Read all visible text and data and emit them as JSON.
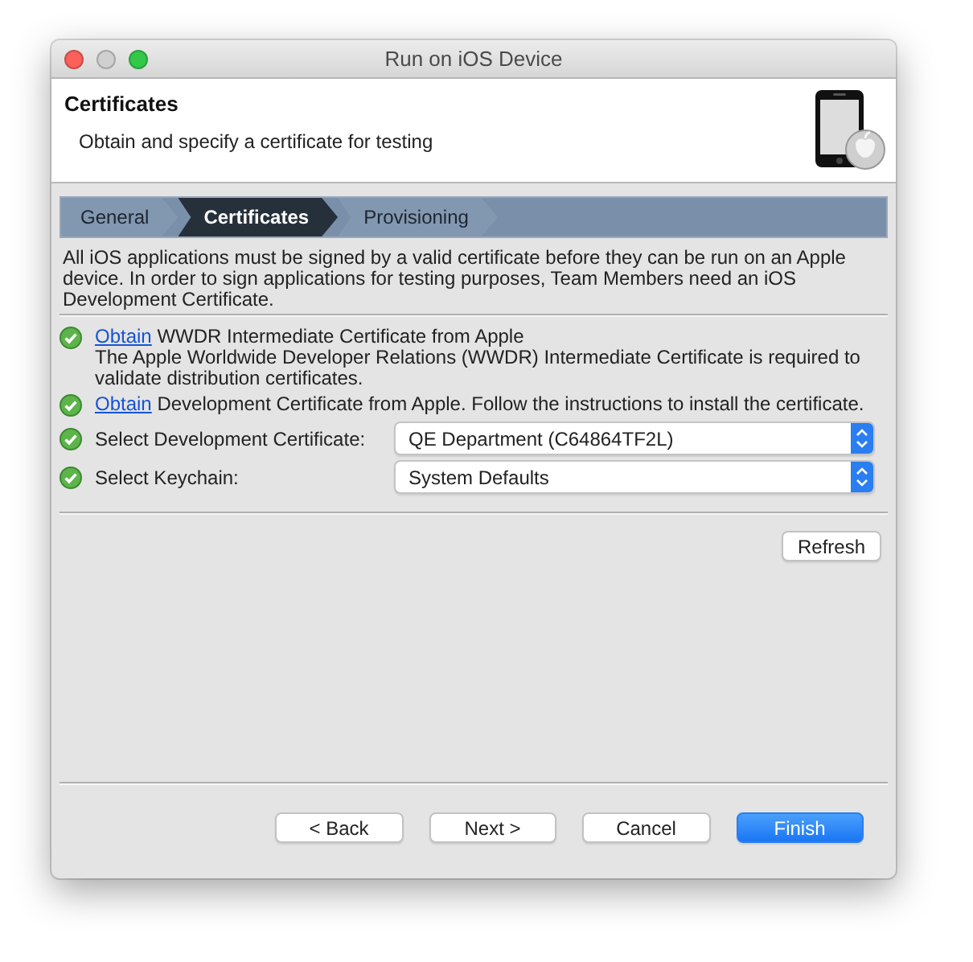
{
  "window": {
    "title": "Run on iOS Device"
  },
  "header": {
    "title": "Certificates",
    "subtitle": "Obtain and specify a certificate for testing"
  },
  "steps": [
    {
      "label": "General",
      "selected": false
    },
    {
      "label": "Certificates",
      "selected": true
    },
    {
      "label": "Provisioning",
      "selected": false
    }
  ],
  "description": "All iOS applications must be signed by a valid certificate before they can be run on an Apple device. In order to sign applications for testing purposes, Team Members need an iOS Development Certificate.",
  "rows": [
    {
      "kind": "link",
      "link": "Obtain",
      "text": "WWDR Intermediate Certificate from Apple",
      "detail": "The Apple Worldwide Developer Relations (WWDR) Intermediate Certificate is required to validate distribution certificates."
    },
    {
      "kind": "link",
      "link": "Obtain",
      "text": "Development Certificate from Apple. Follow the instructions to install the certificate."
    },
    {
      "kind": "select",
      "label": "Select Development Certificate:",
      "value": "QE Department (C64864TF2L)"
    },
    {
      "kind": "select",
      "label": "Select Keychain:",
      "value": "System Defaults"
    }
  ],
  "refresh_button": "Refresh",
  "buttons": [
    {
      "label": "< Back",
      "default": false
    },
    {
      "label": "Next >",
      "default": false
    },
    {
      "label": "Cancel",
      "default": false
    },
    {
      "label": "Finish",
      "default": true
    }
  ]
}
